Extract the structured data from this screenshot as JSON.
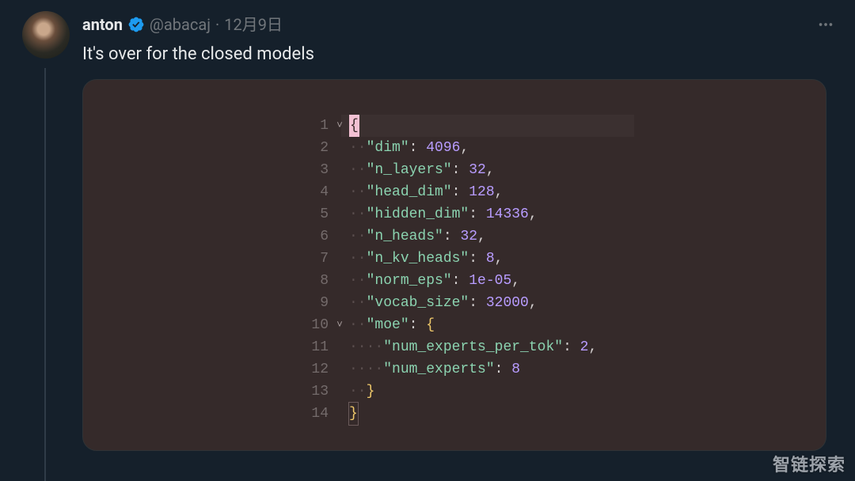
{
  "tweet": {
    "author_name": "anton",
    "handle": "@abacaj",
    "date": "12月9日",
    "separator": "·",
    "text": "It's over for the closed models"
  },
  "code": {
    "lines": [
      {
        "n": "1",
        "fold": "˅",
        "indent": 0,
        "tokens": [
          {
            "t": "sel-brace",
            "v": "{"
          }
        ]
      },
      {
        "n": "2",
        "fold": "",
        "indent": 1,
        "tokens": [
          {
            "t": "key",
            "v": "\"dim\""
          },
          {
            "t": "punc",
            "v": ": "
          },
          {
            "t": "num",
            "v": "4096"
          },
          {
            "t": "punc",
            "v": ","
          }
        ]
      },
      {
        "n": "3",
        "fold": "",
        "indent": 1,
        "tokens": [
          {
            "t": "key",
            "v": "\"n_layers\""
          },
          {
            "t": "punc",
            "v": ": "
          },
          {
            "t": "num",
            "v": "32"
          },
          {
            "t": "punc",
            "v": ","
          }
        ]
      },
      {
        "n": "4",
        "fold": "",
        "indent": 1,
        "tokens": [
          {
            "t": "key",
            "v": "\"head_dim\""
          },
          {
            "t": "punc",
            "v": ": "
          },
          {
            "t": "num",
            "v": "128"
          },
          {
            "t": "punc",
            "v": ","
          }
        ]
      },
      {
        "n": "5",
        "fold": "",
        "indent": 1,
        "tokens": [
          {
            "t": "key",
            "v": "\"hidden_dim\""
          },
          {
            "t": "punc",
            "v": ": "
          },
          {
            "t": "num",
            "v": "14336"
          },
          {
            "t": "punc",
            "v": ","
          }
        ]
      },
      {
        "n": "6",
        "fold": "",
        "indent": 1,
        "tokens": [
          {
            "t": "key",
            "v": "\"n_heads\""
          },
          {
            "t": "punc",
            "v": ": "
          },
          {
            "t": "num",
            "v": "32"
          },
          {
            "t": "punc",
            "v": ","
          }
        ]
      },
      {
        "n": "7",
        "fold": "",
        "indent": 1,
        "tokens": [
          {
            "t": "key",
            "v": "\"n_kv_heads\""
          },
          {
            "t": "punc",
            "v": ": "
          },
          {
            "t": "num",
            "v": "8"
          },
          {
            "t": "punc",
            "v": ","
          }
        ]
      },
      {
        "n": "8",
        "fold": "",
        "indent": 1,
        "tokens": [
          {
            "t": "key",
            "v": "\"norm_eps\""
          },
          {
            "t": "punc",
            "v": ": "
          },
          {
            "t": "num",
            "v": "1e-05"
          },
          {
            "t": "punc",
            "v": ","
          }
        ]
      },
      {
        "n": "9",
        "fold": "",
        "indent": 1,
        "tokens": [
          {
            "t": "key",
            "v": "\"vocab_size\""
          },
          {
            "t": "punc",
            "v": ": "
          },
          {
            "t": "num",
            "v": "32000"
          },
          {
            "t": "punc",
            "v": ","
          }
        ]
      },
      {
        "n": "10",
        "fold": "˅",
        "indent": 1,
        "tokens": [
          {
            "t": "key",
            "v": "\"moe\""
          },
          {
            "t": "punc",
            "v": ": "
          },
          {
            "t": "brace",
            "v": "{"
          }
        ]
      },
      {
        "n": "11",
        "fold": "",
        "indent": 2,
        "tokens": [
          {
            "t": "key",
            "v": "\"num_experts_per_tok\""
          },
          {
            "t": "punc",
            "v": ": "
          },
          {
            "t": "num",
            "v": "2"
          },
          {
            "t": "punc",
            "v": ","
          }
        ]
      },
      {
        "n": "12",
        "fold": "",
        "indent": 2,
        "tokens": [
          {
            "t": "key",
            "v": "\"num_experts\""
          },
          {
            "t": "punc",
            "v": ": "
          },
          {
            "t": "num",
            "v": "8"
          }
        ]
      },
      {
        "n": "13",
        "fold": "",
        "indent": 1,
        "tokens": [
          {
            "t": "brace",
            "v": "}"
          }
        ]
      },
      {
        "n": "14",
        "fold": "",
        "indent": 0,
        "tokens": [
          {
            "t": "brace matched-brace",
            "v": "}"
          }
        ]
      }
    ],
    "indent_glyph": "··"
  },
  "watermark": "智链探索"
}
